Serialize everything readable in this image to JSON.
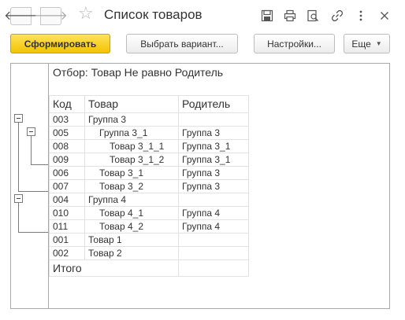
{
  "window": {
    "title": "Список товаров",
    "back_glyph": "🡐",
    "forward_glyph": "🡒"
  },
  "toolbar_icons": [
    "save-icon",
    "print-icon",
    "print-preview-icon",
    "link-icon",
    "more-icon",
    "close-icon"
  ],
  "commands": {
    "generate": "Сформировать",
    "select_variant": "Выбрать вариант...",
    "settings": "Настройки...",
    "more": "Еще"
  },
  "report": {
    "filter": "Отбор: Товар Не равно Родитель",
    "columns": [
      "Код",
      "Товар",
      "Родитель"
    ],
    "rows": [
      {
        "code": "003",
        "product": "Группа 3",
        "parent": "",
        "level": 0
      },
      {
        "code": "005",
        "product": "Группа 3_1",
        "parent": "Группа 3",
        "level": 1
      },
      {
        "code": "008",
        "product": "Товар 3_1_1",
        "parent": "Группа 3_1",
        "level": 2
      },
      {
        "code": "009",
        "product": "Товар 3_1_2",
        "parent": "Группа 3_1",
        "level": 2
      },
      {
        "code": "006",
        "product": "Товар 3_1",
        "parent": "Группа 3",
        "level": 1
      },
      {
        "code": "007",
        "product": "Товар 3_2",
        "parent": "Группа 3",
        "level": 1
      },
      {
        "code": "004",
        "product": "Группа 4",
        "parent": "",
        "level": 0
      },
      {
        "code": "010",
        "product": "Товар 4_1",
        "parent": "Группа 4",
        "level": 1
      },
      {
        "code": "011",
        "product": "Товар 4_2",
        "parent": "Группа 4",
        "level": 1
      },
      {
        "code": "001",
        "product": "Товар 1",
        "parent": "",
        "level": 0
      },
      {
        "code": "002",
        "product": "Товар 2",
        "parent": "",
        "level": 0
      }
    ],
    "total_label": "Итого"
  },
  "colors": {
    "primary_button": "#f3c300",
    "border": "#a8a8a8",
    "grid_line": "#e2e2e2"
  }
}
